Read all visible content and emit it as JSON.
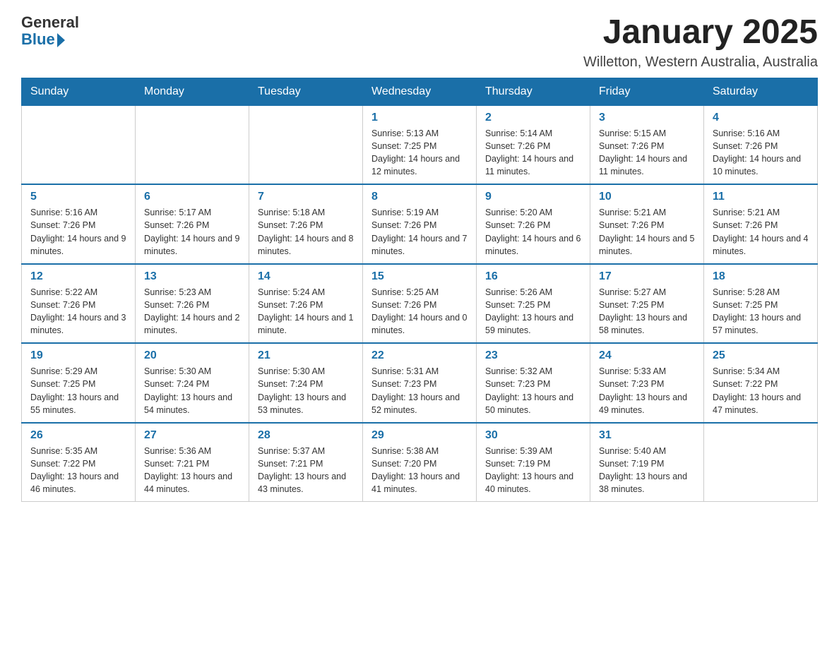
{
  "header": {
    "logo_general": "General",
    "logo_blue": "Blue",
    "month_title": "January 2025",
    "location": "Willetton, Western Australia, Australia"
  },
  "days_of_week": [
    "Sunday",
    "Monday",
    "Tuesday",
    "Wednesday",
    "Thursday",
    "Friday",
    "Saturday"
  ],
  "weeks": [
    [
      {
        "day": "",
        "info": ""
      },
      {
        "day": "",
        "info": ""
      },
      {
        "day": "",
        "info": ""
      },
      {
        "day": "1",
        "info": "Sunrise: 5:13 AM\nSunset: 7:25 PM\nDaylight: 14 hours and 12 minutes."
      },
      {
        "day": "2",
        "info": "Sunrise: 5:14 AM\nSunset: 7:26 PM\nDaylight: 14 hours and 11 minutes."
      },
      {
        "day": "3",
        "info": "Sunrise: 5:15 AM\nSunset: 7:26 PM\nDaylight: 14 hours and 11 minutes."
      },
      {
        "day": "4",
        "info": "Sunrise: 5:16 AM\nSunset: 7:26 PM\nDaylight: 14 hours and 10 minutes."
      }
    ],
    [
      {
        "day": "5",
        "info": "Sunrise: 5:16 AM\nSunset: 7:26 PM\nDaylight: 14 hours and 9 minutes."
      },
      {
        "day": "6",
        "info": "Sunrise: 5:17 AM\nSunset: 7:26 PM\nDaylight: 14 hours and 9 minutes."
      },
      {
        "day": "7",
        "info": "Sunrise: 5:18 AM\nSunset: 7:26 PM\nDaylight: 14 hours and 8 minutes."
      },
      {
        "day": "8",
        "info": "Sunrise: 5:19 AM\nSunset: 7:26 PM\nDaylight: 14 hours and 7 minutes."
      },
      {
        "day": "9",
        "info": "Sunrise: 5:20 AM\nSunset: 7:26 PM\nDaylight: 14 hours and 6 minutes."
      },
      {
        "day": "10",
        "info": "Sunrise: 5:21 AM\nSunset: 7:26 PM\nDaylight: 14 hours and 5 minutes."
      },
      {
        "day": "11",
        "info": "Sunrise: 5:21 AM\nSunset: 7:26 PM\nDaylight: 14 hours and 4 minutes."
      }
    ],
    [
      {
        "day": "12",
        "info": "Sunrise: 5:22 AM\nSunset: 7:26 PM\nDaylight: 14 hours and 3 minutes."
      },
      {
        "day": "13",
        "info": "Sunrise: 5:23 AM\nSunset: 7:26 PM\nDaylight: 14 hours and 2 minutes."
      },
      {
        "day": "14",
        "info": "Sunrise: 5:24 AM\nSunset: 7:26 PM\nDaylight: 14 hours and 1 minute."
      },
      {
        "day": "15",
        "info": "Sunrise: 5:25 AM\nSunset: 7:26 PM\nDaylight: 14 hours and 0 minutes."
      },
      {
        "day": "16",
        "info": "Sunrise: 5:26 AM\nSunset: 7:25 PM\nDaylight: 13 hours and 59 minutes."
      },
      {
        "day": "17",
        "info": "Sunrise: 5:27 AM\nSunset: 7:25 PM\nDaylight: 13 hours and 58 minutes."
      },
      {
        "day": "18",
        "info": "Sunrise: 5:28 AM\nSunset: 7:25 PM\nDaylight: 13 hours and 57 minutes."
      }
    ],
    [
      {
        "day": "19",
        "info": "Sunrise: 5:29 AM\nSunset: 7:25 PM\nDaylight: 13 hours and 55 minutes."
      },
      {
        "day": "20",
        "info": "Sunrise: 5:30 AM\nSunset: 7:24 PM\nDaylight: 13 hours and 54 minutes."
      },
      {
        "day": "21",
        "info": "Sunrise: 5:30 AM\nSunset: 7:24 PM\nDaylight: 13 hours and 53 minutes."
      },
      {
        "day": "22",
        "info": "Sunrise: 5:31 AM\nSunset: 7:23 PM\nDaylight: 13 hours and 52 minutes."
      },
      {
        "day": "23",
        "info": "Sunrise: 5:32 AM\nSunset: 7:23 PM\nDaylight: 13 hours and 50 minutes."
      },
      {
        "day": "24",
        "info": "Sunrise: 5:33 AM\nSunset: 7:23 PM\nDaylight: 13 hours and 49 minutes."
      },
      {
        "day": "25",
        "info": "Sunrise: 5:34 AM\nSunset: 7:22 PM\nDaylight: 13 hours and 47 minutes."
      }
    ],
    [
      {
        "day": "26",
        "info": "Sunrise: 5:35 AM\nSunset: 7:22 PM\nDaylight: 13 hours and 46 minutes."
      },
      {
        "day": "27",
        "info": "Sunrise: 5:36 AM\nSunset: 7:21 PM\nDaylight: 13 hours and 44 minutes."
      },
      {
        "day": "28",
        "info": "Sunrise: 5:37 AM\nSunset: 7:21 PM\nDaylight: 13 hours and 43 minutes."
      },
      {
        "day": "29",
        "info": "Sunrise: 5:38 AM\nSunset: 7:20 PM\nDaylight: 13 hours and 41 minutes."
      },
      {
        "day": "30",
        "info": "Sunrise: 5:39 AM\nSunset: 7:19 PM\nDaylight: 13 hours and 40 minutes."
      },
      {
        "day": "31",
        "info": "Sunrise: 5:40 AM\nSunset: 7:19 PM\nDaylight: 13 hours and 38 minutes."
      },
      {
        "day": "",
        "info": ""
      }
    ]
  ]
}
